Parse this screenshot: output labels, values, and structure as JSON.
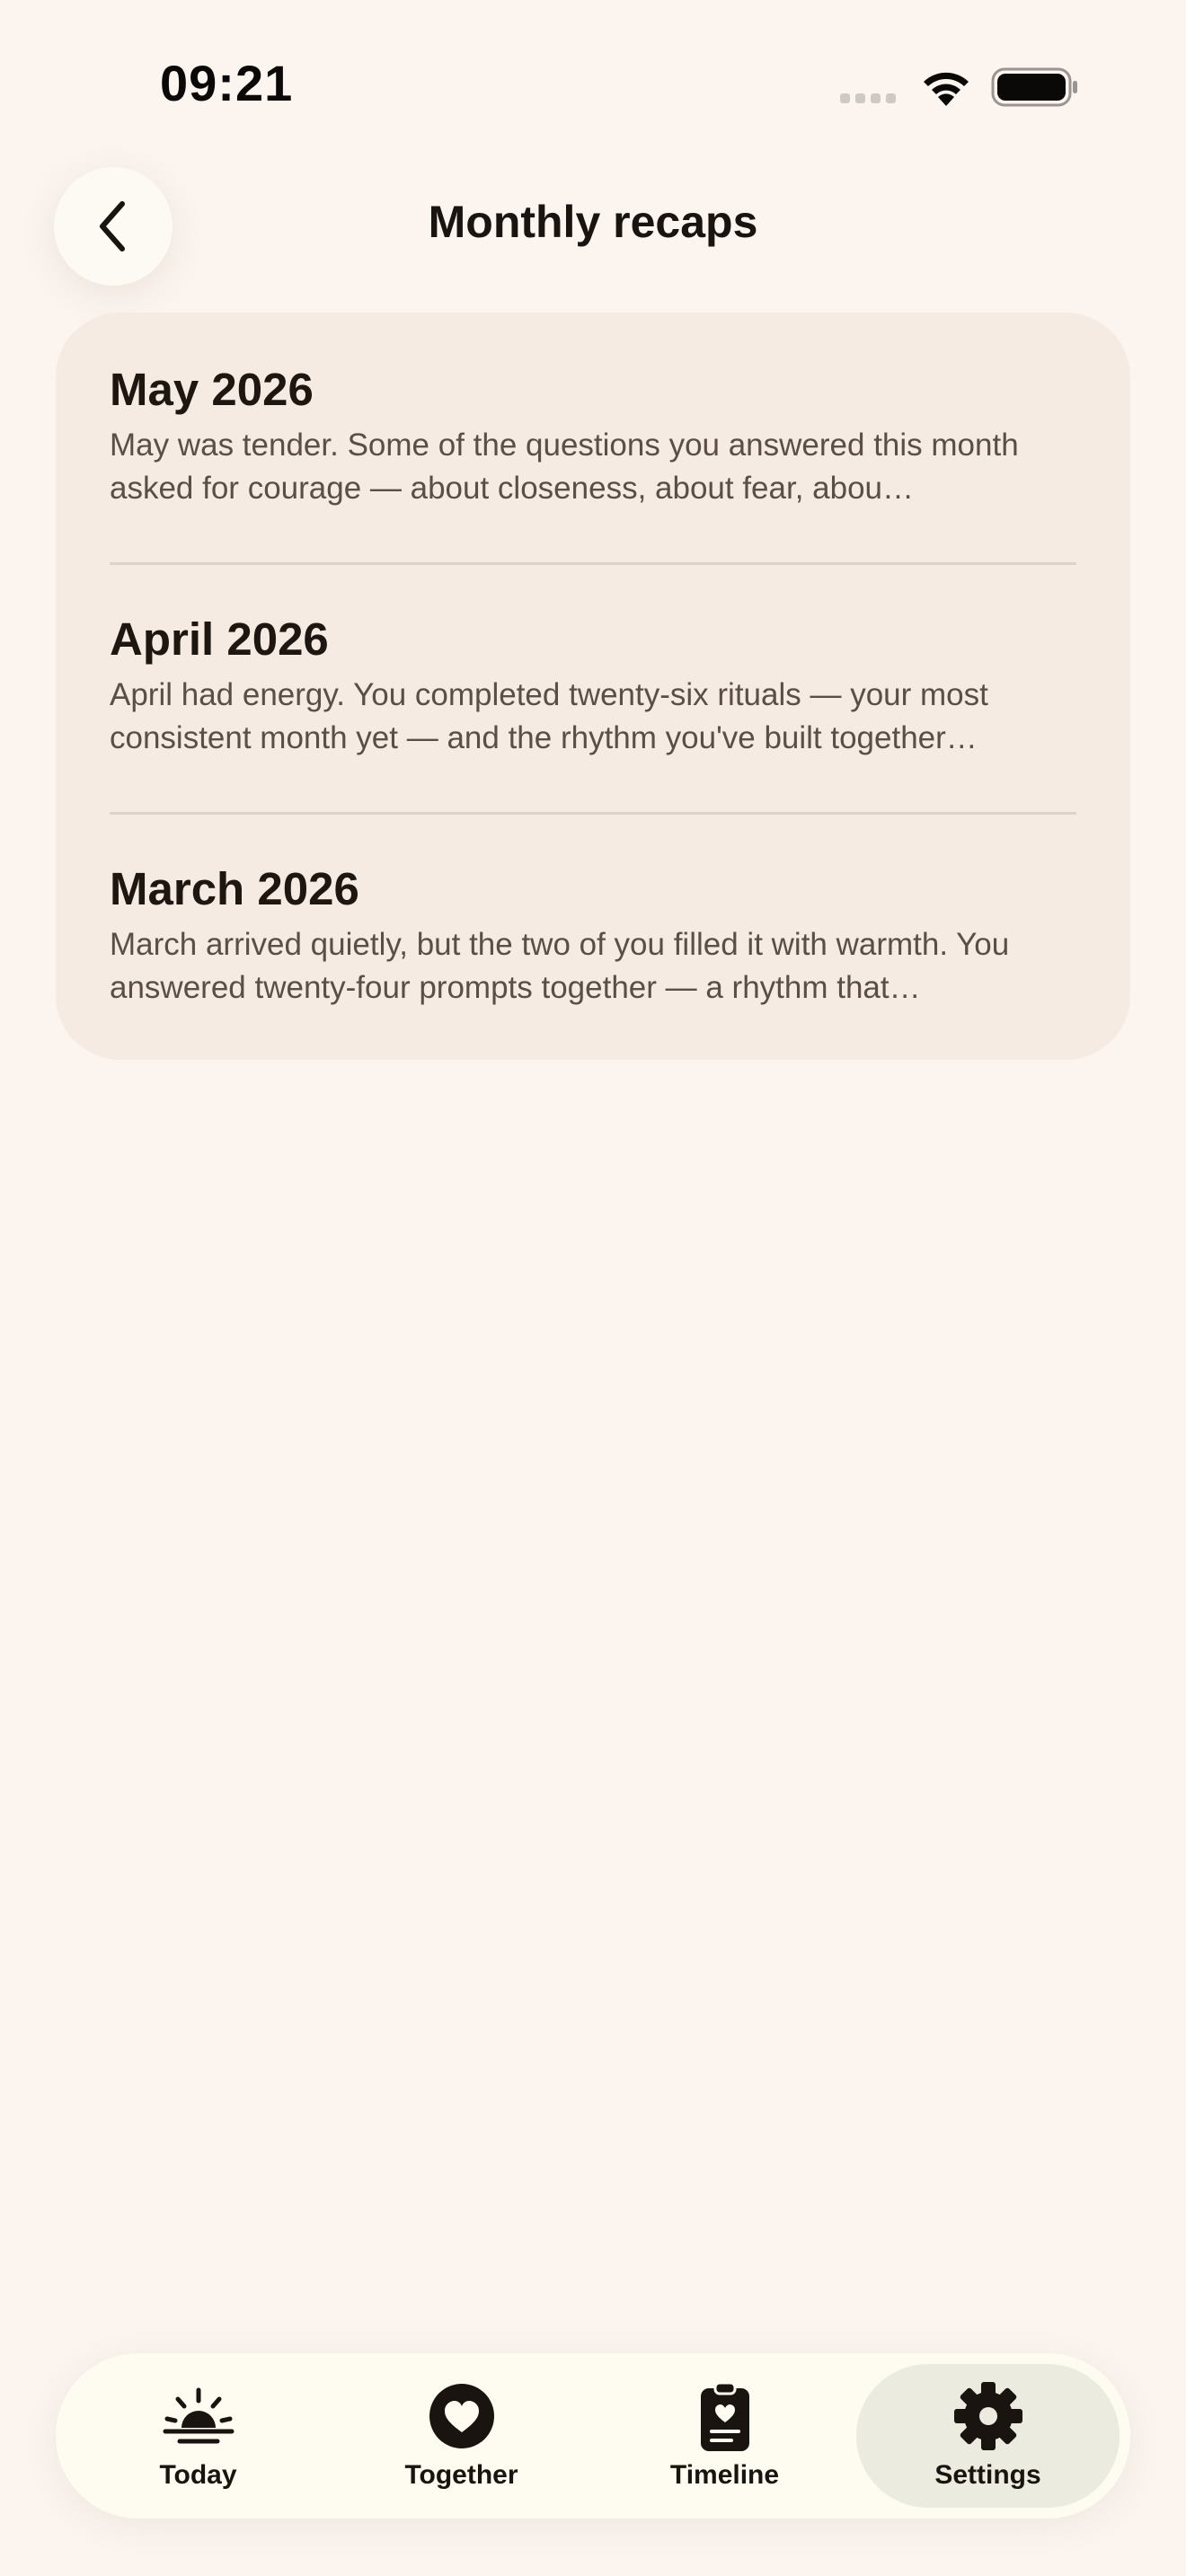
{
  "status_bar": {
    "time": "09:21",
    "icons": [
      "signal-dots-icon",
      "wifi-icon",
      "battery-icon"
    ]
  },
  "header": {
    "back_icon": "chevron-left-icon",
    "title": "Monthly recaps"
  },
  "recaps": [
    {
      "month": "May 2026",
      "summary": "May was tender. Some of the questions you answered this month asked for courage — about closeness, about fear, abou…"
    },
    {
      "month": "April 2026",
      "summary": "April had energy. You completed twenty-six rituals — your most consistent month yet — and the rhythm you've built together…"
    },
    {
      "month": "March 2026",
      "summary": "March arrived quietly, but the two of you filled it with warmth. You answered twenty-four prompts together — a rhythm that…"
    }
  ],
  "tab_bar": {
    "active": "Settings",
    "tabs": [
      {
        "label": "Today",
        "icon": "sunrise-icon"
      },
      {
        "label": "Together",
        "icon": "heart-circle-icon"
      },
      {
        "label": "Timeline",
        "icon": "clipboard-heart-icon"
      },
      {
        "label": "Settings",
        "icon": "gear-icon"
      }
    ]
  },
  "colors": {
    "background": "#fbf4ef",
    "card": "#f5ebe3",
    "tab_bar": "#fefbf1",
    "active_tab": "#ecebe0",
    "text_primary": "#1d1611",
    "text_secondary": "#5a4e46"
  }
}
